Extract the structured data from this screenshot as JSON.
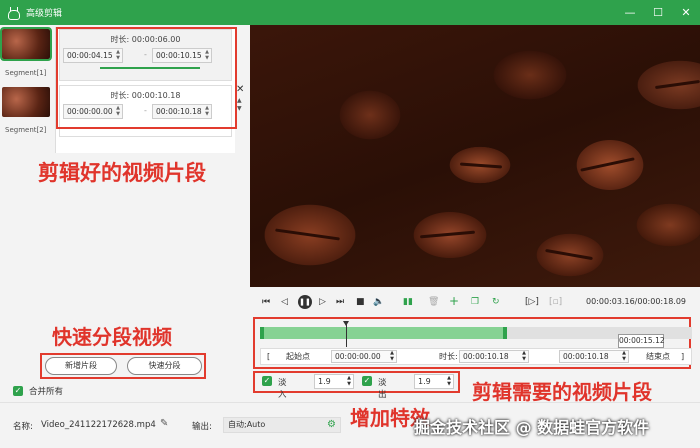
{
  "window": {
    "title": "高级剪辑",
    "controls": [
      "minimize",
      "maximize",
      "close"
    ]
  },
  "segments_list": [
    {
      "label": "Segment[1]"
    },
    {
      "label": "Segment[2]"
    }
  ],
  "segment_details": [
    {
      "duration_label": "时长:",
      "duration": "00:00:06.00",
      "start": "00:00:04.15",
      "end": "00:00:10.15"
    },
    {
      "duration_label": "时长:",
      "duration": "00:00:10.18",
      "start": "00:00:00.00",
      "end": "00:00:10.18"
    }
  ],
  "segment_separator": "-",
  "annotations": {
    "segments": "剪辑好的视频片段",
    "quick_split": "快速分段视频",
    "needed_segment": "剪辑需要的视频片段",
    "effects": "增加特效",
    "watermark": "掘金技术社区 @ 数据蛙官方软件"
  },
  "buttons": {
    "new_segment": "新增片段",
    "quick_split": "快速分段"
  },
  "merge_all": {
    "label": "合并所有",
    "checked": true
  },
  "player": {
    "time_readout": "00:00:03.16/00:00:18.09",
    "tooltip_time": "00:00:15.12"
  },
  "range": {
    "start_label": "起始点",
    "start_value": "00:00:00.00",
    "duration_label": "时长:",
    "duration_value": "00:00:10.18",
    "end_value": "00:00:10.18",
    "end_label": "结束点"
  },
  "effects": {
    "fade_in_label": "淡入",
    "fade_in_value": "1.9",
    "fade_out_label": "淡出",
    "fade_out_value": "1.9",
    "fade_in_checked": true,
    "fade_out_checked": true
  },
  "bottom": {
    "name_label": "名称:",
    "name_value": "Video_241122172628.mp4",
    "output_label": "输出:",
    "output_value": "自动;Auto"
  },
  "colors": {
    "accent": "#2fa24c",
    "annotation": "#e0342b",
    "selection_fill": "#86d293"
  }
}
